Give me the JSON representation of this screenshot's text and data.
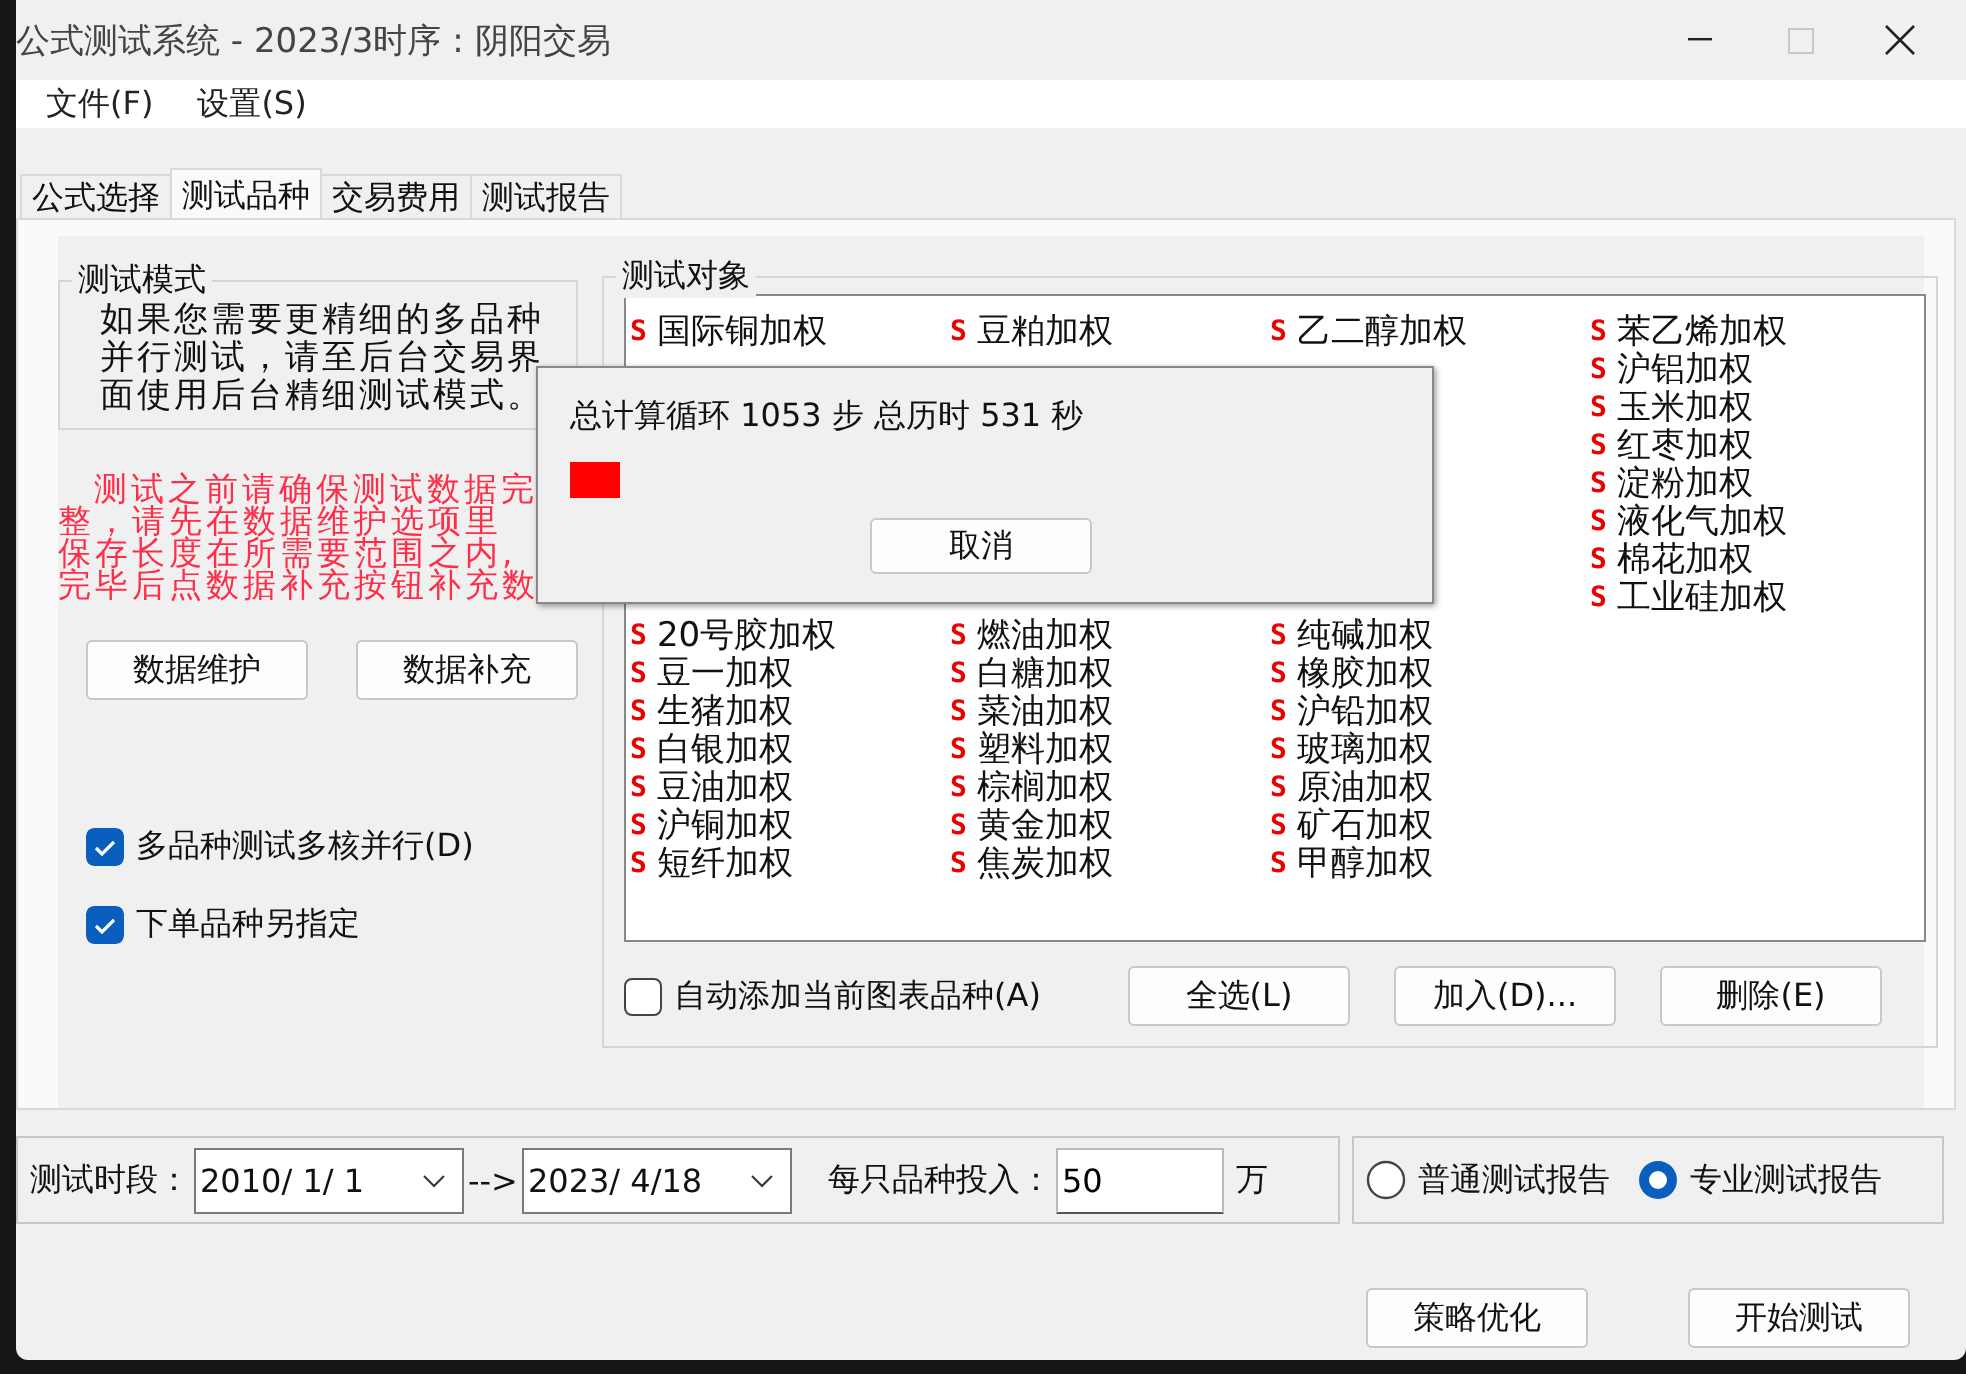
{
  "window": {
    "title": "公式测试系统 - 2023/3时序 : 阴阳交易",
    "maximize_disabled": true
  },
  "menu": [
    "文件(F)",
    "设置(S)"
  ],
  "tabs": [
    {
      "label": "公式选择",
      "selected": false
    },
    {
      "label": "测试品种",
      "selected": true
    },
    {
      "label": "交易费用",
      "selected": false
    },
    {
      "label": "测试报告",
      "selected": false
    }
  ],
  "mode_group": {
    "title": "测试模式",
    "text": "如果您需要更精细的多品种并行测试，请至后台交易界面使用后台精细测试模式。"
  },
  "warning_lines": [
    "测试之前请确保测试数据完",
    "整，请先在数据维护选项里",
    "保存长度在所需要范围之内,",
    "完毕后点数据补充按钮补充数"
  ],
  "data_buttons": [
    "数据维护",
    "数据补充"
  ],
  "options": [
    {
      "label": "多品种测试多核并行(D)",
      "checked": true
    },
    {
      "label": "下单品种另指定",
      "checked": true
    }
  ],
  "targets": {
    "title": "测试对象",
    "rows": [
      [
        {
          "mark": "S",
          "name": "国际铜加权"
        },
        {
          "mark": "S",
          "name": "豆粕加权"
        },
        {
          "mark": "S",
          "name": "乙二醇加权"
        },
        {
          "mark": "S",
          "name": "苯乙烯加权"
        }
      ],
      [
        null,
        null,
        null,
        {
          "mark": "S",
          "name": "沪铝加权"
        }
      ],
      [
        null,
        null,
        null,
        {
          "mark": "S",
          "name": "玉米加权"
        }
      ],
      [
        null,
        null,
        null,
        {
          "mark": "S",
          "name": "红枣加权"
        }
      ],
      [
        null,
        null,
        null,
        {
          "mark": "S",
          "name": "淀粉加权"
        }
      ],
      [
        null,
        null,
        null,
        {
          "mark": "S",
          "name": "液化气加权"
        }
      ],
      [
        null,
        null,
        null,
        {
          "mark": "S",
          "name": "棉花加权"
        }
      ],
      [
        null,
        null,
        null,
        {
          "mark": "S",
          "name": "工业硅加权"
        }
      ],
      [
        {
          "mark": "S",
          "name": "20号胶加权"
        },
        {
          "mark": "S",
          "name": "燃油加权"
        },
        {
          "mark": "S",
          "name": "纯碱加权"
        },
        null
      ],
      [
        {
          "mark": "S",
          "name": "豆一加权"
        },
        {
          "mark": "S",
          "name": "白糖加权"
        },
        {
          "mark": "S",
          "name": "橡胶加权"
        },
        null
      ],
      [
        {
          "mark": "S",
          "name": "生猪加权"
        },
        {
          "mark": "S",
          "name": "菜油加权"
        },
        {
          "mark": "S",
          "name": "沪铅加权"
        },
        null
      ],
      [
        {
          "mark": "S",
          "name": "白银加权"
        },
        {
          "mark": "S",
          "name": "塑料加权"
        },
        {
          "mark": "S",
          "name": "玻璃加权"
        },
        null
      ],
      [
        {
          "mark": "S",
          "name": "豆油加权"
        },
        {
          "mark": "S",
          "name": "棕榈加权"
        },
        {
          "mark": "S",
          "name": "原油加权"
        },
        null
      ],
      [
        {
          "mark": "S",
          "name": "沪铜加权"
        },
        {
          "mark": "S",
          "name": "黄金加权"
        },
        {
          "mark": "S",
          "name": "矿石加权"
        },
        null
      ],
      [
        {
          "mark": "S",
          "name": "短纤加权"
        },
        {
          "mark": "S",
          "name": "焦炭加权"
        },
        {
          "mark": "S",
          "name": "甲醇加权"
        },
        null
      ]
    ],
    "auto_add": {
      "label": "自动添加当前图表品种(A)",
      "checked": false
    },
    "buttons": [
      "全选(L)",
      "加入(D)...",
      "删除(E)"
    ]
  },
  "period": {
    "label": "测试时段：",
    "start": "2010/ 1/ 1",
    "arrow": "-->",
    "end": "2023/ 4/18",
    "invest_label": "每只品种投入：",
    "invest_value": "50",
    "unit": "万"
  },
  "report_type": [
    {
      "label": "普通测试报告",
      "selected": false
    },
    {
      "label": "专业测试报告",
      "selected": true
    }
  ],
  "actions": [
    "策略优化",
    "开始测试"
  ],
  "progress_dialog": {
    "message": "总计算循环 1053 步 总历时 531 秒",
    "level": 0.06,
    "button": "取消"
  }
}
